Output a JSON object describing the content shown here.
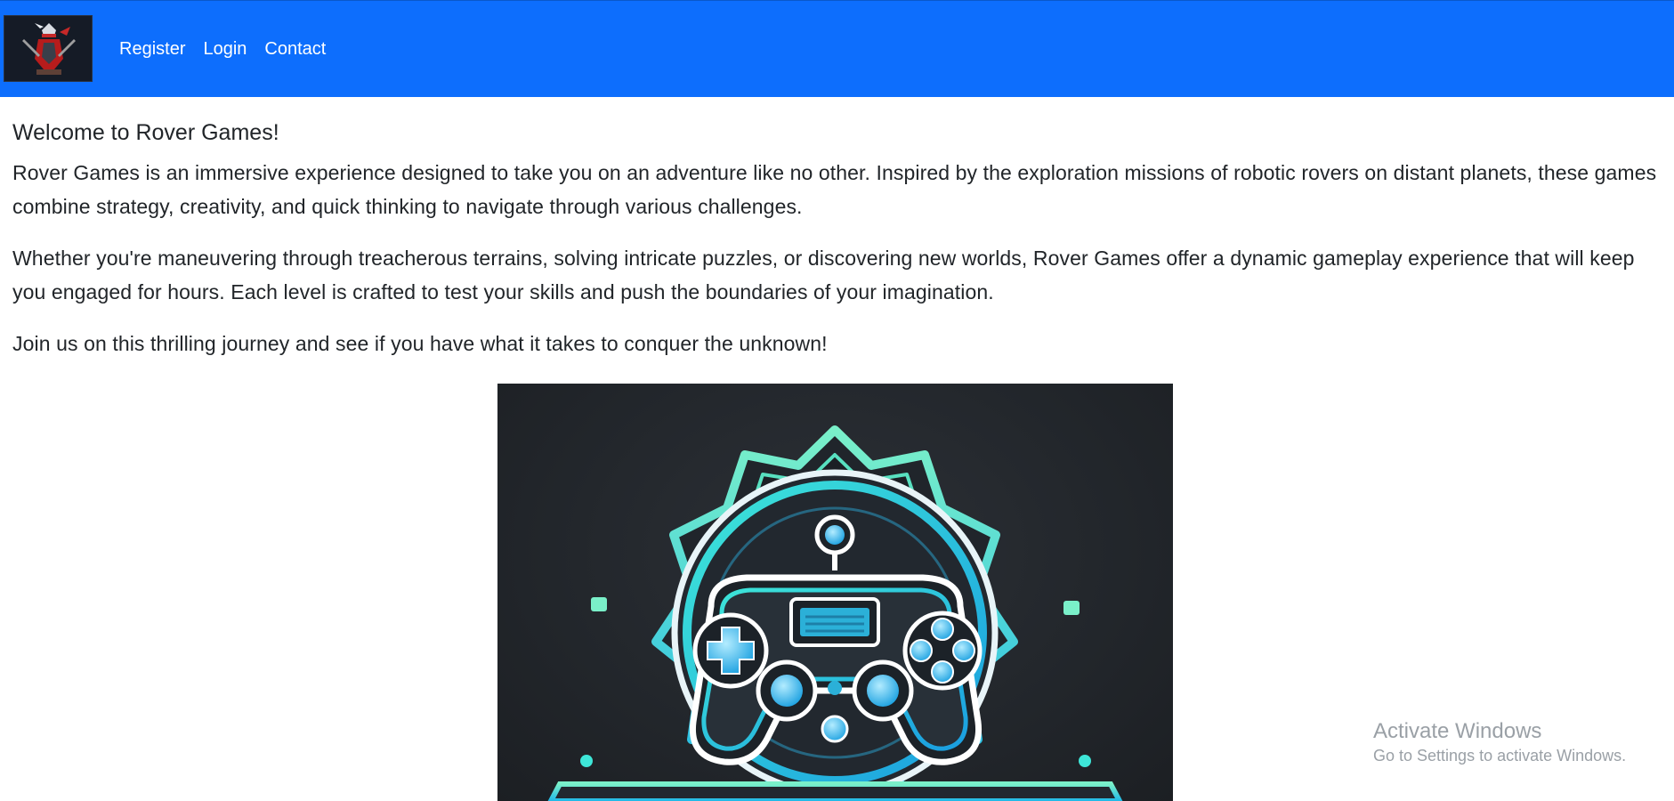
{
  "nav": {
    "logo_name": "ninja-logo",
    "links": [
      "Register",
      "Login",
      "Contact"
    ]
  },
  "main": {
    "welcome": "Welcome to Rover Games!",
    "paragraphs": [
      "Rover Games is an immersive experience designed to take you on an adventure like no other. Inspired by the exploration missions of robotic rovers on distant planets, these games combine strategy, creativity, and quick thinking to navigate through various challenges.",
      "Whether you're maneuvering through treacherous terrains, solving intricate puzzles, or discovering new worlds, Rover Games offer a dynamic gameplay experience that will keep you engaged for hours. Each level is crafted to test your skills and push the boundaries of your imagination.",
      "Join us on this thrilling journey and see if you have what it takes to conquer the unknown!"
    ],
    "hero_image": "gamepad-emblem"
  },
  "watermark": {
    "title": "Activate Windows",
    "subtitle": "Go to Settings to activate Windows."
  },
  "colors": {
    "navbar": "#0d6efd",
    "text": "#212529",
    "accent_teal": "#3fe0c8",
    "accent_cyan": "#29b6f6"
  }
}
